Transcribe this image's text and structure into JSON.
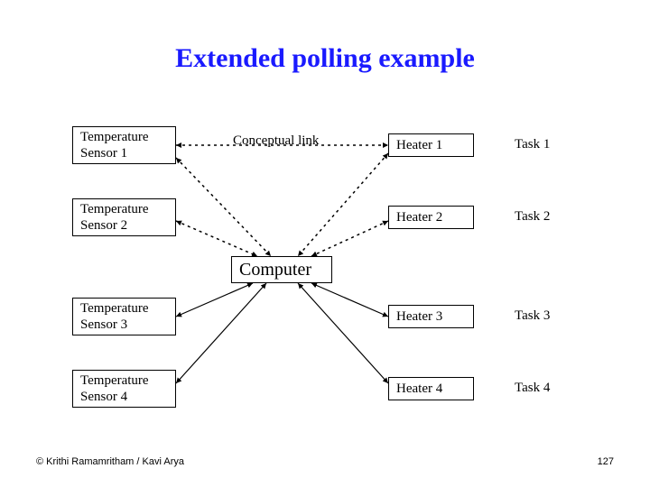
{
  "title": "Extended polling example",
  "center_top_label": "Conceptual link",
  "center_label": "Computer",
  "left_boxes": [
    "Temperature\nSensor 1",
    "Temperature\nSensor 2",
    "Temperature\nSensor 3",
    "Temperature\nSensor 4"
  ],
  "right_boxes": [
    "Heater 1",
    "Heater 2",
    "Heater 3",
    "Heater 4"
  ],
  "task_labels": [
    "Task 1",
    "Task 2",
    "Task 3",
    "Task 4"
  ],
  "footer_left": "© Krithi Ramamritham / Kavi Arya",
  "footer_right": "127"
}
